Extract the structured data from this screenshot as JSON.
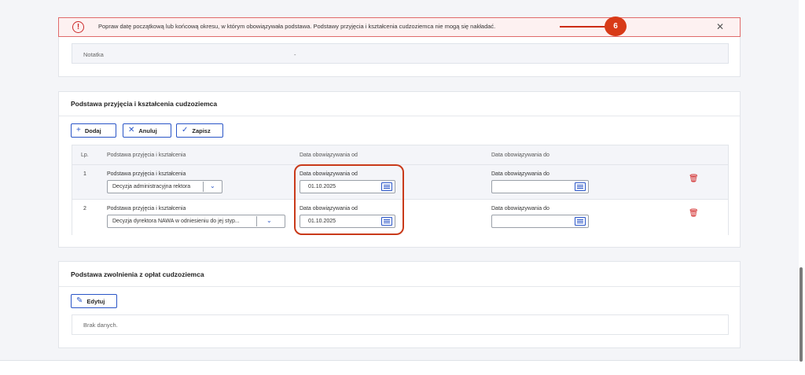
{
  "alert": {
    "icon": "alert-circle-icon",
    "message": "Popraw datę początkową lub końcową okresu, w którym obowiązywała podstawa. Podstawy przyjęcia i kształcenia cudzoziemca nie mogą się nakładać.",
    "close_symbol": "✕",
    "annotation_number": "6",
    "accent_color": "#e06b6b"
  },
  "note": {
    "label": "Notatka",
    "value": "-"
  },
  "admission_section": {
    "title": "Podstawa przyjęcia i kształcenia cudzoziemca",
    "buttons": {
      "add": "Dodaj",
      "cancel": "Anuluj",
      "save": "Zapisz"
    },
    "columns": {
      "lp": "Lp.",
      "basis": "Podstawa przyjęcia i kształcenia",
      "date_from": "Data obowiązywania od",
      "date_to": "Data obowiązywania do"
    },
    "rows": [
      {
        "lp": "1",
        "basis_label": "Podstawa przyjęcia i kształcenia",
        "basis_value": "Decyzja administracyjna rektora",
        "date_from_label": "Data obowiązywania od",
        "date_from_value": "01.10.2025",
        "date_to_label": "Data obowiązywania do",
        "date_to_value": ""
      },
      {
        "lp": "2",
        "basis_label": "Podstawa przyjęcia i kształcenia",
        "basis_value": "Decyzja dyrektora NAWA w odniesieniu do jej styp...",
        "date_from_label": "Data obowiązywania od",
        "date_from_value": "01.10.2025",
        "date_to_label": "Data obowiązywania do",
        "date_to_value": ""
      }
    ]
  },
  "exemption_section": {
    "title": "Podstawa zwolnienia z opłat cudzoziemca",
    "edit_button": "Edytuj",
    "empty_text": "Brak danych."
  },
  "colors": {
    "primary": "#2a55c7",
    "danger": "#d02020",
    "annotation": "#d83a17"
  }
}
